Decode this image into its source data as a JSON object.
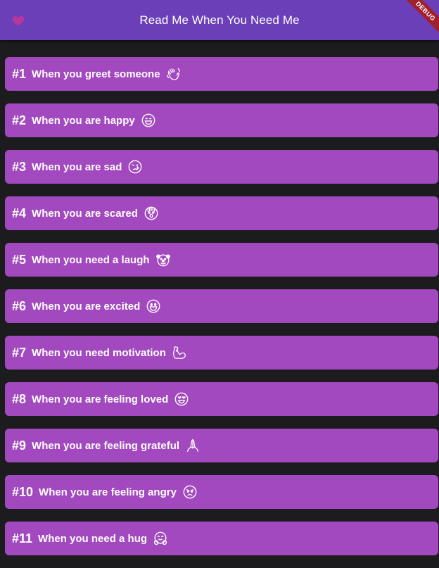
{
  "appbar": {
    "title": "Read Me When You Need Me",
    "icon": "heart-icon",
    "debug_label": "DEBUG"
  },
  "colors": {
    "appbar": "#6a3fb8",
    "background": "#1c1b1d",
    "card": "#a349bf",
    "heart": "#b5379f",
    "text": "#ffffff"
  },
  "items": [
    {
      "number": "#1",
      "label": "When you greet someone",
      "icon": "waving-hand-icon"
    },
    {
      "number": "#2",
      "label": "When you are happy",
      "icon": "grinning-face-icon"
    },
    {
      "number": "#3",
      "label": "When you are sad",
      "icon": "crying-face-icon"
    },
    {
      "number": "#4",
      "label": "When you are scared",
      "icon": "screaming-face-icon"
    },
    {
      "number": "#5",
      "label": "When you need a laugh",
      "icon": "clown-face-icon"
    },
    {
      "number": "#6",
      "label": "When you are excited",
      "icon": "big-smile-face-icon"
    },
    {
      "number": "#7",
      "label": "When you need motivation",
      "icon": "flexed-biceps-icon"
    },
    {
      "number": "#8",
      "label": "When you are feeling loved",
      "icon": "heart-eyes-face-icon"
    },
    {
      "number": "#9",
      "label": "When you are feeling grateful",
      "icon": "folded-hands-icon"
    },
    {
      "number": "#10",
      "label": "When you are feeling angry",
      "icon": "angry-face-icon"
    },
    {
      "number": "#11",
      "label": "When you need a hug",
      "icon": "hugging-face-icon"
    }
  ]
}
